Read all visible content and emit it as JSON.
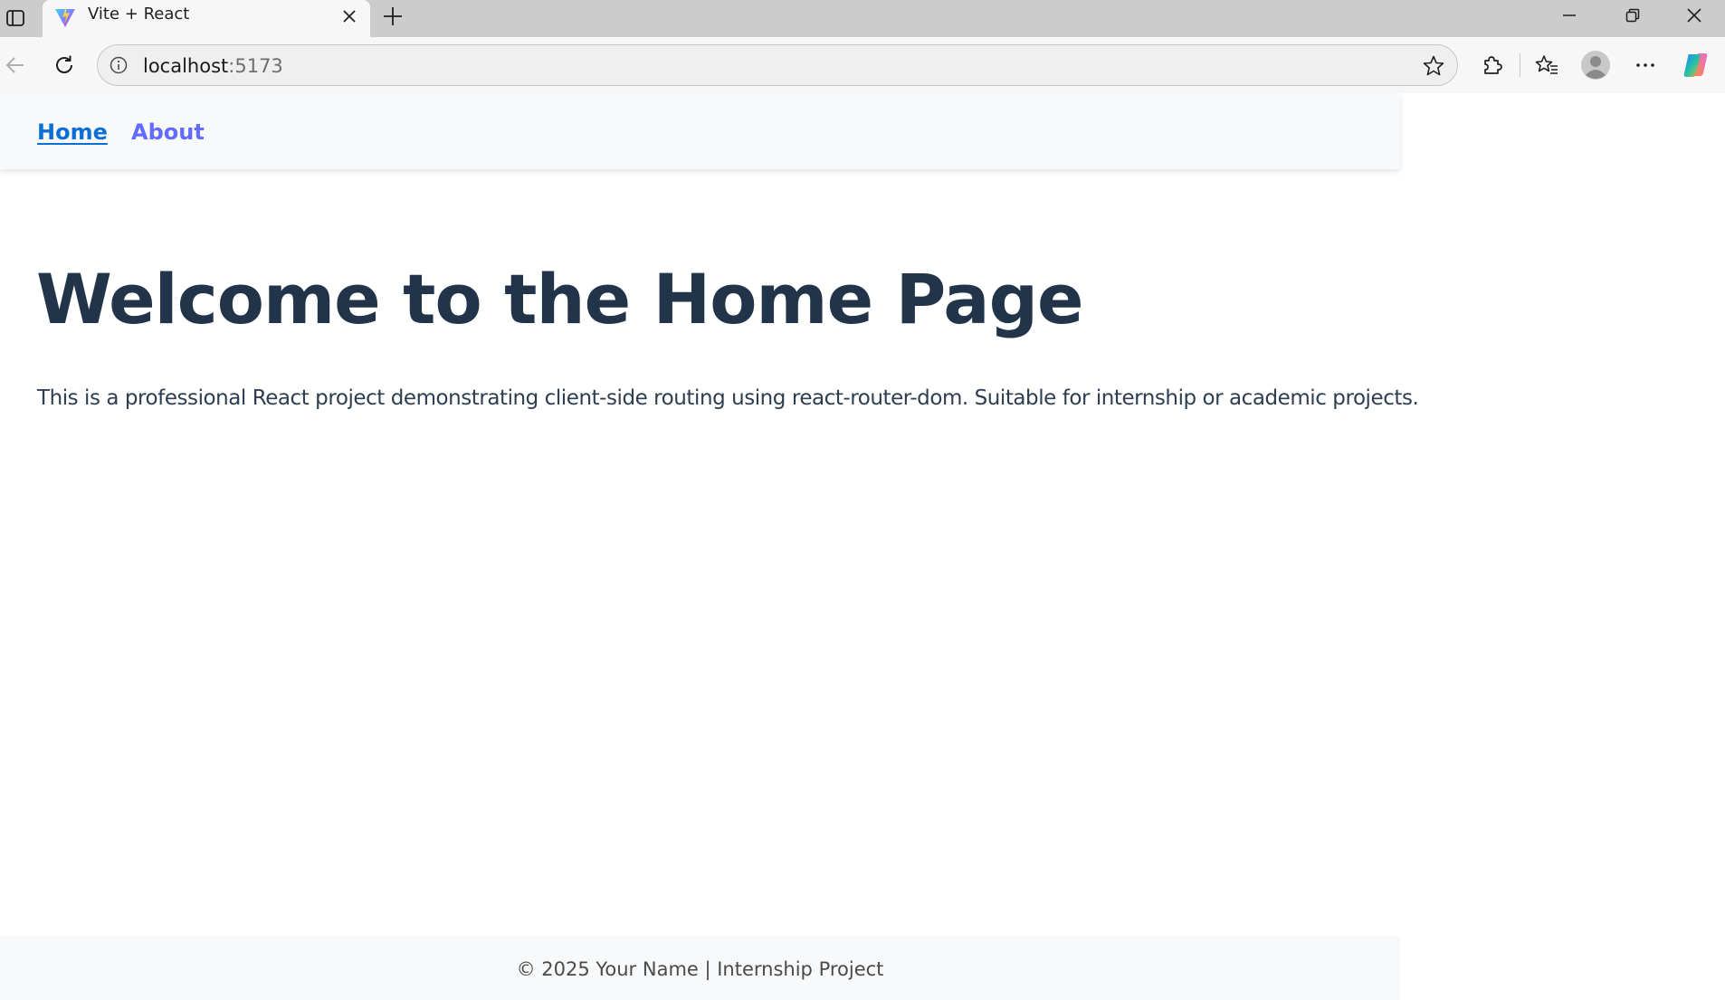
{
  "browser": {
    "tab": {
      "title": "Vite + React",
      "favicon": "vite-logo-icon"
    },
    "address": {
      "host": "localhost",
      "port": ":5173"
    },
    "icons": {
      "tab_actions": "tab-actions-icon",
      "close_tab": "close-icon",
      "new_tab": "plus-icon",
      "minimize": "minimize-icon",
      "restore": "restore-icon",
      "close_window": "close-icon",
      "back": "back-arrow-icon",
      "refresh": "refresh-icon",
      "site_info": "info-icon",
      "favorite": "star-icon",
      "extensions": "puzzle-icon",
      "favorites": "favorites-icon",
      "profile": "avatar-icon",
      "more": "more-icon",
      "copilot": "copilot-icon"
    }
  },
  "nav": {
    "home": "Home",
    "about": "About"
  },
  "main": {
    "heading": "Welcome to the Home Page",
    "intro": "This is a professional React project demonstrating client-side routing using react-router-dom. Suitable for internship or academic projects."
  },
  "footer": {
    "text": "© 2025 Your Name | Internship Project"
  },
  "colors": {
    "nav_home": "#0d6fd6",
    "nav_about": "#646cff",
    "heading": "#22344a",
    "body_text": "#2c3e50",
    "nav_background": "#f8f9fa"
  }
}
